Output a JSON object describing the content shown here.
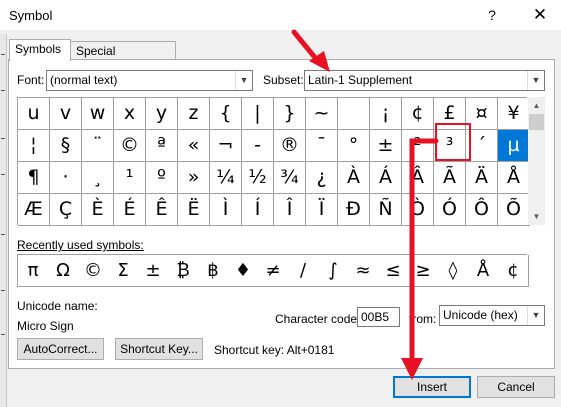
{
  "window": {
    "title": "Symbol",
    "help_glyph": "?",
    "close_glyph": "✕"
  },
  "tabs": [
    {
      "label": "Symbols",
      "active": true
    },
    {
      "label": "Special Characters",
      "active": false
    }
  ],
  "font": {
    "label": "Font:",
    "value": "(normal text)"
  },
  "subset": {
    "label": "Subset:",
    "value": "Latin-1 Supplement"
  },
  "symbol_grid": {
    "rows": [
      [
        "u",
        "v",
        "w",
        "x",
        "y",
        "z",
        "{",
        "|",
        "}",
        "~",
        "",
        "¡",
        "¢",
        "£",
        "¤",
        "¥"
      ],
      [
        "¦",
        "§",
        "¨",
        "©",
        "ª",
        "«",
        "¬",
        "-",
        "®",
        "¯",
        "°",
        "±",
        "²",
        "³",
        "´",
        "µ"
      ],
      [
        "¶",
        "·",
        "¸",
        "¹",
        "º",
        "»",
        "¼",
        "½",
        "¾",
        "¿",
        "À",
        "Á",
        "Â",
        "Ã",
        "Ä",
        "Å"
      ],
      [
        "Æ",
        "Ç",
        "È",
        "É",
        "Ê",
        "Ë",
        "Ì",
        "Í",
        "Î",
        "Ï",
        "Ð",
        "Ñ",
        "Ò",
        "Ó",
        "Ô",
        "Õ"
      ]
    ],
    "selected": "µ"
  },
  "recent": {
    "label": "Recently used symbols:",
    "symbols": [
      "π",
      "Ω",
      "©",
      "Σ",
      "±",
      "₿",
      "฿",
      "♦",
      "≠",
      "/",
      "∫",
      "≈",
      "≤",
      "≥",
      "◊",
      "Å",
      "¢"
    ]
  },
  "unicode": {
    "label": "Unicode name:",
    "value": "Micro Sign"
  },
  "character_code": {
    "label": "Character code:",
    "value": "00B5"
  },
  "from": {
    "label": "from:",
    "value": "Unicode (hex)"
  },
  "buttons": {
    "autocorrect": "AutoCorrect...",
    "shortcut_key": "Shortcut Key...",
    "insert": "Insert",
    "cancel": "Cancel"
  },
  "shortcut_text": "Shortcut key: Alt+0181",
  "colors": {
    "selection": "#0078d7",
    "annotation": "#e81123"
  },
  "icons": {
    "dropdown": "chevron-down-icon",
    "scroll_up": "scroll-up-icon",
    "scroll_down": "scroll-down-icon"
  }
}
